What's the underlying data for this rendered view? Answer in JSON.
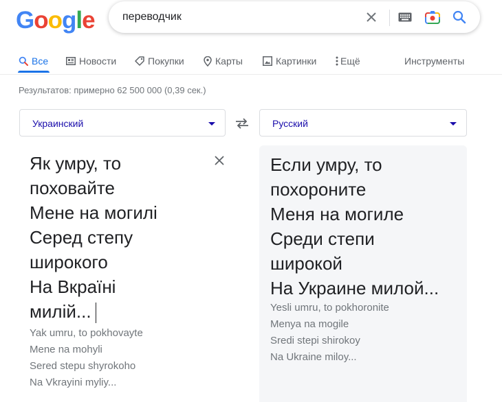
{
  "logo": {
    "text": "Google",
    "letters": [
      "G",
      "o",
      "o",
      "g",
      "l",
      "e"
    ],
    "colors": [
      "#4285f4",
      "#ea4335",
      "#fbbc05",
      "#4285f4",
      "#34a853",
      "#ea4335"
    ]
  },
  "search": {
    "query": "переводчик"
  },
  "tabs": [
    {
      "label": "Все",
      "icon": "search-icon"
    },
    {
      "label": "Новости",
      "icon": "news-icon"
    },
    {
      "label": "Покупки",
      "icon": "tag-icon"
    },
    {
      "label": "Карты",
      "icon": "map-pin-icon"
    },
    {
      "label": "Картинки",
      "icon": "image-icon"
    },
    {
      "label": "Ещё",
      "icon": "more-vertical-icon"
    }
  ],
  "tools_label": "Инструменты",
  "results_count": "Результатов: примерно 62 500 000 (0,39 сек.)",
  "translator": {
    "source_lang": "Украинский",
    "target_lang": "Русский",
    "source_lines": [
      "Як умру, то",
      "поховайте",
      "Мене на могилі",
      "Серед степу",
      "широкого",
      "На Вкраїні",
      "милій..."
    ],
    "source_translit": [
      "Yak umru, to pokhovayte",
      "Mene na mohyli",
      "Sered stepu shyrokoho",
      "Na Vkrayini myliy..."
    ],
    "target_lines": [
      "Если умру, то",
      "похороните",
      "Меня на могиле",
      "Среди степи",
      "широкой",
      "На Украине милой..."
    ],
    "target_translit": [
      "Yesli umru, to pokhoronite",
      "Menya na mogile",
      "Sredi stepi shirokoy",
      "Na Ukraine miloy..."
    ]
  },
  "colors": {
    "accent": "#1a73e8",
    "link": "#1a0dab",
    "muted": "#70757a"
  }
}
